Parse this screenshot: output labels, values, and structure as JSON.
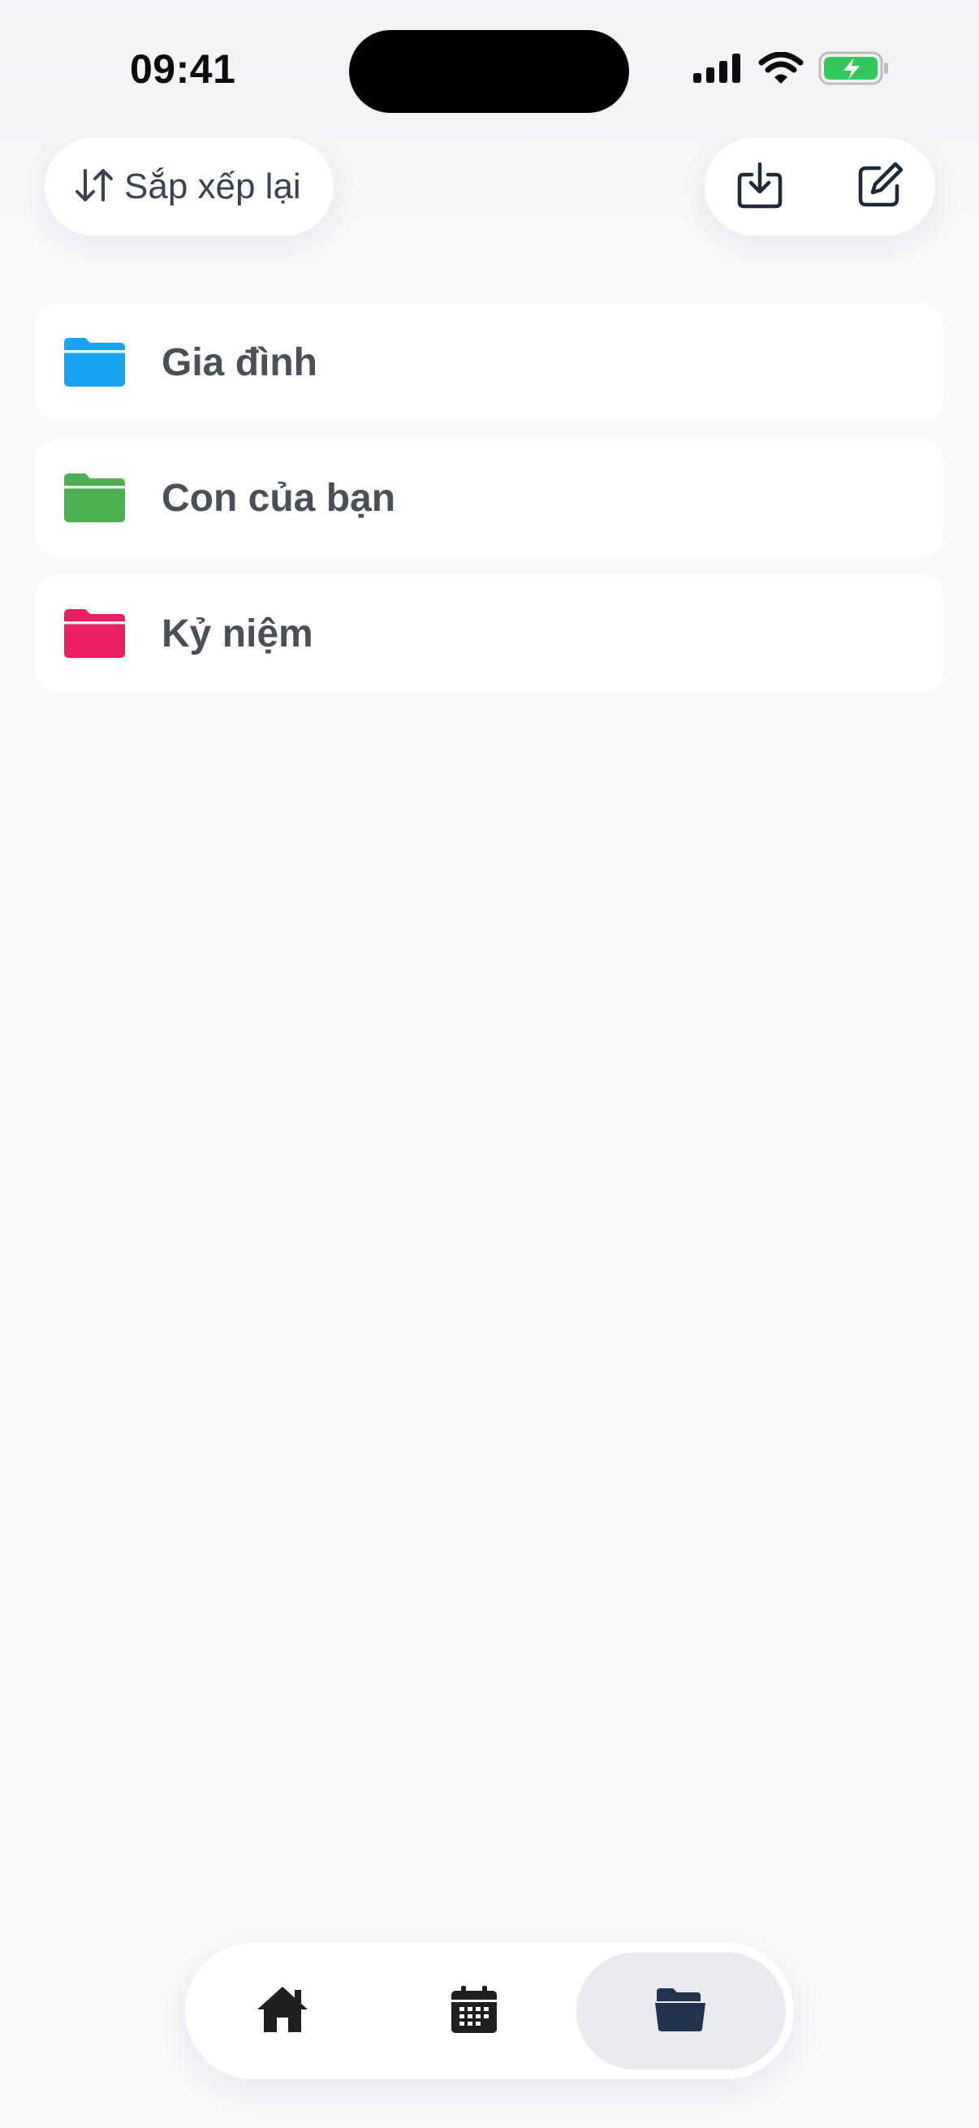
{
  "status_bar": {
    "time": "09:41"
  },
  "toolbar": {
    "sort_label": "Sắp xếp lại"
  },
  "folders": [
    {
      "label": "Gia đình",
      "color": "#1aa3f0"
    },
    {
      "label": "Con của bạn",
      "color": "#4caf50"
    },
    {
      "label": "Kỷ niệm",
      "color": "#e91e63"
    }
  ],
  "tabbar": {
    "tabs": [
      {
        "icon": "home-icon",
        "selected": false
      },
      {
        "icon": "calendar-icon",
        "selected": false
      },
      {
        "icon": "folder-open-icon",
        "selected": true
      }
    ]
  },
  "colors": {
    "background": "#f8f9fb",
    "battery_fill": "#34c759",
    "tab_selected_bg": "#e8eaed",
    "icon_dark": "#1f2937",
    "folder_tab_icon": "#223350"
  }
}
